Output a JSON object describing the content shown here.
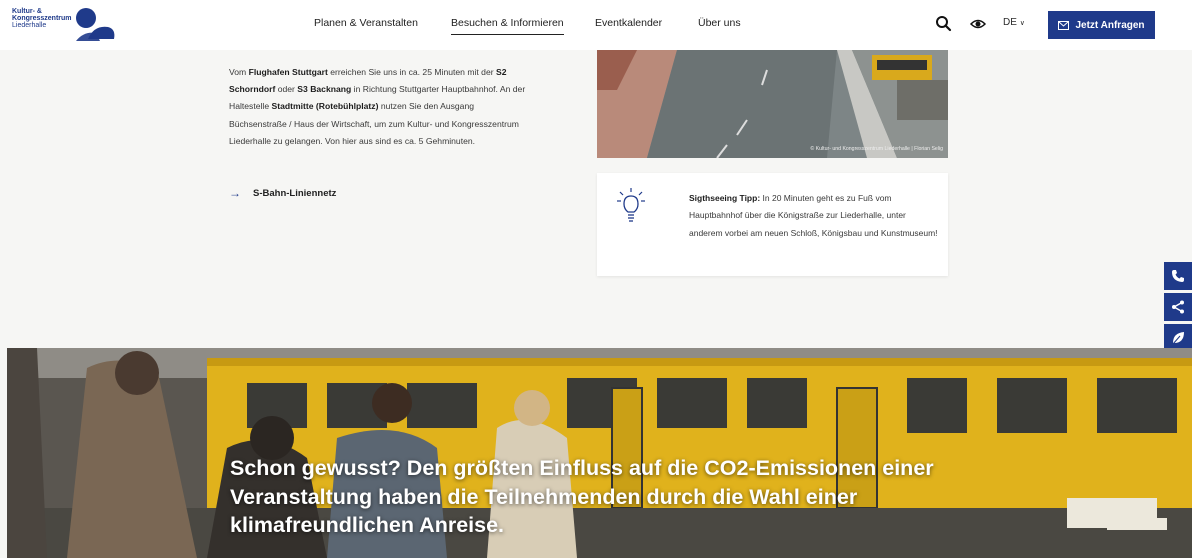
{
  "header": {
    "logo": {
      "line1": "Kultur- &",
      "line2": "Kongresszentrum",
      "line3": "Liederhalle"
    },
    "nav": [
      {
        "label": "Planen & Veranstalten",
        "active": false
      },
      {
        "label": "Besuchen & Informieren",
        "active": true
      },
      {
        "label": "Eventkalender",
        "active": false
      },
      {
        "label": "Über uns",
        "active": false
      }
    ],
    "icons": [
      "search-icon",
      "accessibility-eye-icon"
    ],
    "language": "DE",
    "cta_label": "Jetzt Anfragen"
  },
  "content": {
    "paragraph": {
      "t1": "Vom ",
      "b1": "Flughafen Stuttgart",
      "t2": " erreichen Sie uns in ca. 25 Minuten mit der ",
      "b2": "S2 Schorndorf",
      "t3": " oder ",
      "b3": "S3 Backnang",
      "t4": " in Richtung Stuttgarter Hauptbahnhof. An der Haltestelle ",
      "b4": "Stadtmitte (Rotebühlplatz)",
      "t5": " nutzen Sie den Ausgang Büchsenstraße / Haus der Wirtschaft, um zum Kultur- und Kongresszentrum Liederhalle zu gelangen. Von hier aus sind es ca. 5 Gehminuten."
    },
    "link_label": "S-Bahn-Liniennetz",
    "photo_credit": "© Kultur- und Kongresszentrum Liederhalle | Florian Selig",
    "tip": {
      "bold": "Sigthseeing Tipp:",
      "text": " In 20 Minuten geht es zu Fuß vom Hauptbahnhof über die Königstraße zur Liederhalle, unter anderem vorbei am neuen Schloß, Königsbau und Kunstmuseum!"
    }
  },
  "hero": {
    "text": "Schon gewusst? Den größten Einfluss auf die CO2-Emissionen einer Veranstaltung haben die Teilnehmenden durch die Wahl einer klimafreundlichen Anreise."
  },
  "side_buttons": [
    "phone-icon",
    "share-icon",
    "leaf-icon"
  ],
  "colors": {
    "brand": "#1f3a8a",
    "background": "#f6f6f4",
    "tram_yellow": "#e0b21c"
  }
}
